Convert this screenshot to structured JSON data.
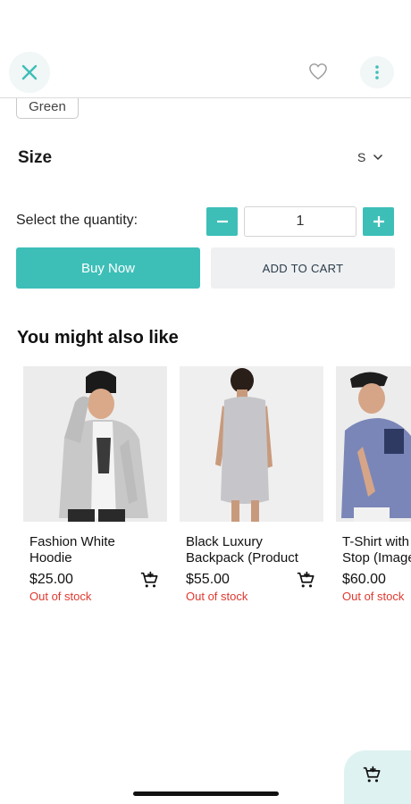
{
  "header": {
    "close_icon": "close-icon",
    "favorite_icon": "heart-outline-icon",
    "more_icon": "more-vertical-icon"
  },
  "color_option": {
    "label": "Green"
  },
  "size": {
    "label": "Size",
    "selected": "S"
  },
  "quantity": {
    "label": "Select the quantity:",
    "value": "1"
  },
  "actions": {
    "buy_now": "Buy Now",
    "add_to_cart": "ADD TO CART"
  },
  "recommendations": {
    "title": "You might also like",
    "items": [
      {
        "name_line1": "Fashion White",
        "name_line2": "Hoodie",
        "price": "$25.00",
        "stock": "Out of stock"
      },
      {
        "name_line1": "Black Luxury",
        "name_line2": "Backpack (Product",
        "price": "$55.00",
        "stock": "Out of stock"
      },
      {
        "name_line1": "T-Shirt with",
        "name_line2": "Stop (Image",
        "price": "$60.00",
        "stock": "Out of stock"
      }
    ]
  },
  "colors": {
    "accent": "#3dbfb8",
    "out_of_stock": "#e0382f",
    "secondary_button": "#eef0f2"
  }
}
